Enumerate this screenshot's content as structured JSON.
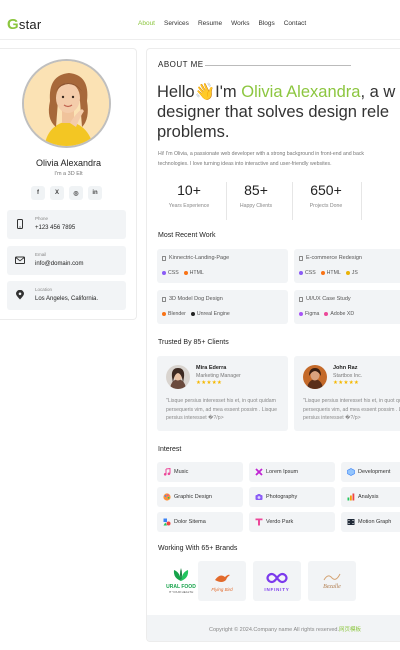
{
  "header": {
    "logo_initial": "G",
    "logo_rest": "star",
    "nav": [
      {
        "label": "About",
        "active": true
      },
      {
        "label": "Services"
      },
      {
        "label": "Resume"
      },
      {
        "label": "Works"
      },
      {
        "label": "Blogs"
      },
      {
        "label": "Contact"
      }
    ]
  },
  "profile": {
    "name": "Olivia Alexandra",
    "role": "I'm a 3D Elt",
    "socials": [
      {
        "icon": "facebook-icon",
        "glyph": "f"
      },
      {
        "icon": "x-twitter-icon",
        "glyph": "X"
      },
      {
        "icon": "instagram-icon",
        "glyph": "◎"
      },
      {
        "icon": "linkedin-icon",
        "glyph": "in"
      }
    ],
    "contacts": [
      {
        "icon": "phone-icon",
        "label": "Phone",
        "value": "+123 456 7895"
      },
      {
        "icon": "mail-icon",
        "label": "Email",
        "value": "info@domain.com"
      },
      {
        "icon": "location-pin-icon",
        "label": "Location",
        "value": "Los Angeles, California."
      }
    ]
  },
  "about": {
    "title": "ABOUT ME",
    "hero_line1_prefix": "Hello",
    "hero_wave": "👋",
    "hero_line1_mid": "I'm ",
    "hero_name": "Olivia Alexandra",
    "hero_line1_suffix": ", a w",
    "hero_line2": "designer that solves design rele",
    "hero_line3": "problems.",
    "bio_line1": "Hi! I'm Olivia, a passionate web developer with a strong background in front-end and back",
    "bio_line2": "technologies. I love turning ideas into interactive and user-friendly websites.",
    "stats": [
      {
        "num": "10+",
        "label": "Years Experience"
      },
      {
        "num": "85+",
        "label": "Happy Clients"
      },
      {
        "num": "650+",
        "label": "Projects Done"
      }
    ]
  },
  "works": {
    "title": "Most Recent Work",
    "items": [
      {
        "title": "Kinnectric-Landing-Page",
        "tags": [
          {
            "name": "CSS",
            "color": "#8b5cf6"
          },
          {
            "name": "HTML",
            "color": "#f97316"
          }
        ]
      },
      {
        "title": "E-commerce Redesign",
        "tags": [
          {
            "name": "CSS",
            "color": "#8b5cf6"
          },
          {
            "name": "HTML",
            "color": "#f97316"
          },
          {
            "name": "JS",
            "color": "#eab308"
          }
        ]
      },
      {
        "title": "3D Model Dog Design",
        "tags": [
          {
            "name": "Blender",
            "color": "#f97316"
          },
          {
            "name": "Unreal Engine",
            "color": "#222222"
          }
        ]
      },
      {
        "title": "UI/UX Case Study",
        "tags": [
          {
            "name": "Figma",
            "color": "#a855f7"
          },
          {
            "name": "Adobe XD",
            "color": "#ec4899"
          }
        ]
      }
    ]
  },
  "testimonials": {
    "title": "Trusted By 85+ Clients",
    "items": [
      {
        "name": "Mira Ederra",
        "role": "Marketing Manager",
        "stars": "★★★★★",
        "quote": "\"Lisque persius interesset his et, in quot quidam persequeris vim, ad mea essent possim . Lisque persius interesset �?/p>"
      },
      {
        "name": "John Raz",
        "role": "Startbox Inc.",
        "stars": "★★★★★",
        "quote": "\"Lisque persius interesset his et, in quot quidam persequeris vim, ad mea essent possim . Lisque persius interesset �?/p>"
      }
    ]
  },
  "interests": {
    "title": "Interest",
    "items": [
      {
        "label": "Music",
        "icon": "music-note-icon",
        "color": "#ec4899"
      },
      {
        "label": "Lorem Ipsum",
        "icon": "cross-x-icon",
        "color": "#c026d3"
      },
      {
        "label": "Development",
        "icon": "cube-icon",
        "color": "#3b82f6"
      },
      {
        "label": "Graphic Design",
        "icon": "palette-icon",
        "color": "#f97316"
      },
      {
        "label": "Photography",
        "icon": "camera-icon",
        "color": "#8b5cf6"
      },
      {
        "label": "Analysis",
        "icon": "bar-chart-icon",
        "color": "#f59e0b"
      },
      {
        "label": "Dolor Sitema",
        "icon": "shapes-icon",
        "color": "#3b82f6"
      },
      {
        "label": "Verdo Park",
        "icon": "letter-t-icon",
        "color": "#ec4899"
      },
      {
        "label": "Motion Graph",
        "icon": "film-icon",
        "color": "#1f2937"
      }
    ]
  },
  "brands": {
    "title": "Working With 65+ Brands",
    "items": [
      {
        "name": "URAL FOOD",
        "sub": "IT YOUR HEALTH",
        "color": "#16a34a"
      },
      {
        "name": "Flying Bird",
        "sub": "",
        "color": "#e26a2c"
      },
      {
        "name": "INFINITY",
        "sub": "",
        "color": "#7c3aed"
      },
      {
        "name": "Bezalle",
        "sub": "",
        "color": "#d4a373"
      }
    ]
  },
  "footer": {
    "text": "Copyright © 2024.Company name All rights reserved.",
    "extra": "网页模板"
  },
  "colors": {
    "accent": "#8cc63f",
    "card_bg": "#f2f4f6"
  }
}
